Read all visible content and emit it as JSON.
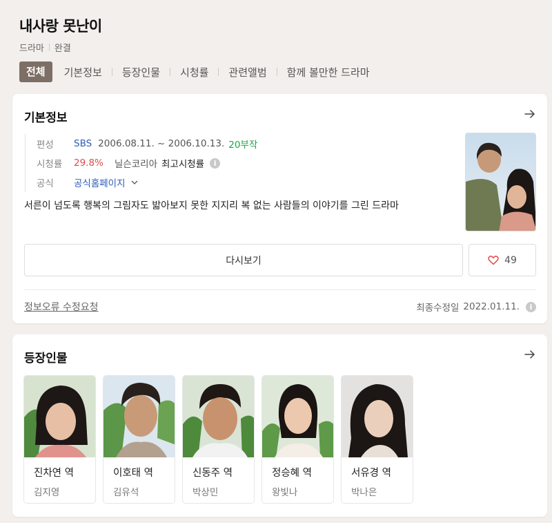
{
  "header": {
    "title": "내사랑 못난이",
    "genre": "드라마",
    "status": "완결",
    "tabs": [
      {
        "label": "전체",
        "active": true
      },
      {
        "label": "기본정보",
        "active": false
      },
      {
        "label": "등장인물",
        "active": false
      },
      {
        "label": "시청률",
        "active": false
      },
      {
        "label": "관련앨범",
        "active": false
      },
      {
        "label": "함께 볼만한 드라마",
        "active": false
      }
    ]
  },
  "basic_info": {
    "title": "기본정보",
    "broadcast_label": "편성",
    "channel": "SBS",
    "period": "2006.08.11. ~ 2006.10.13.",
    "episodes": "20부작",
    "rating_label": "시청률",
    "rating": "29.8%",
    "rating_source": "닐슨코리아",
    "rating_type": "최고시청률",
    "official_label": "공식",
    "official_link": "공식홈페이지",
    "description": "서른이 넘도록 행복의 그림자도 밟아보지 못한 지지리 복 없는 사람들의 이야기를 그린 드라마",
    "replay_label": "다시보기",
    "likes": "49",
    "report_label": "정보오류 수정요청",
    "updated_label": "최종수정일",
    "updated_date": "2022.01.11."
  },
  "cast": {
    "title": "등장인물",
    "members": [
      {
        "role": "진차연 역",
        "actor": "김지영"
      },
      {
        "role": "이호태 역",
        "actor": "김유석"
      },
      {
        "role": "신동주 역",
        "actor": "박상민"
      },
      {
        "role": "정승혜 역",
        "actor": "왕빛나"
      },
      {
        "role": "서유경 역",
        "actor": "박나은"
      }
    ]
  },
  "colors": {
    "active_tab": "#7d6f66",
    "link_blue": "#2d5cb8",
    "episodes_green": "#19a54a",
    "rating_red": "#e34848"
  }
}
